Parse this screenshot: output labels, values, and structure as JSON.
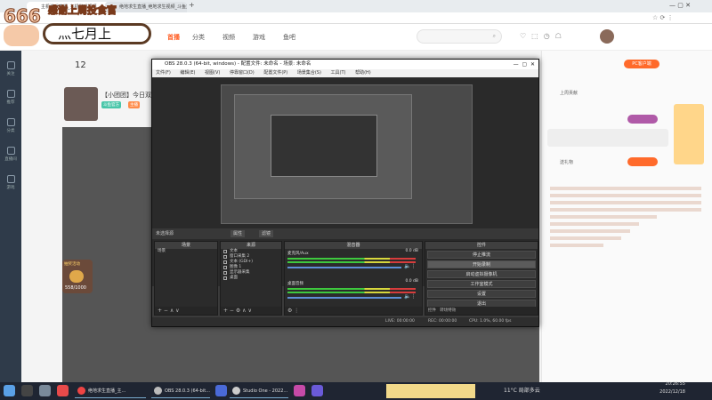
{
  "browser": {
    "tabs": [
      {
        "label": "主机游戏直播_主机游戏视频 ..."
      },
      {
        "label": "绝地求生直播_绝地求生视频_斗鱼直播"
      }
    ],
    "tab_new": "+"
  },
  "site": {
    "nav": [
      "首播",
      "分类",
      "视频",
      "游戏",
      "鱼吧"
    ],
    "active_nav": "首播",
    "search_placeholder": "",
    "user_count": "12"
  },
  "overlay": {
    "logo": "666",
    "banner": "感谢上周投食官",
    "pill_name": "灬七月上"
  },
  "left_rail": [
    "关注",
    "推荐",
    "分类",
    "直播间",
    "游戏"
  ],
  "anchor": {
    "name": "【小团团】今日双",
    "tags": [
      "斗鱼官方",
      "主播"
    ]
  },
  "obs": {
    "title": "OBS 28.0.3 (64-bit, windows) - 配置文件: 未命名 - 场景: 未命名",
    "menu": [
      "文件(F)",
      "编辑(E)",
      "视图(V)",
      "停靠窗口(D)",
      "配置文件(P)",
      "场景集合(S)",
      "工具(T)",
      "帮助(H)"
    ],
    "source_bar_label": "未选择源",
    "source_bar_buttons": [
      "属性",
      "滤镜"
    ],
    "docks": {
      "scenes": {
        "title": "场景",
        "items": [
          "场景"
        ]
      },
      "sources": {
        "title": "来源",
        "items": [
          "文本",
          "窗口采集 2",
          "文本 (GDI+)",
          "图像 1",
          "显示器采集",
          "桌面"
        ]
      },
      "mixer": {
        "title": "混音器",
        "channels": [
          {
            "name": "麦克风/Aux",
            "db": "0.0 dB"
          },
          {
            "name": "桌面音频",
            "db": "0.0 dB"
          }
        ]
      },
      "controls": {
        "title": "控件",
        "buttons": [
          "停止推流",
          "开始录制",
          "启动虚拟摄像机",
          "工作室模式",
          "设置",
          "退出"
        ],
        "tabs": [
          "控件",
          "转场特效"
        ]
      }
    },
    "status": {
      "live": "LIVE: 00:00:00",
      "rec": "REC: 00:00:00",
      "cpu": "CPU: 1.0%, 60.00 fps"
    }
  },
  "right_panel": {
    "chips": [
      "PC客户端"
    ],
    "rank_label": "上周贡献",
    "gift_label": "送礼物"
  },
  "promo": {
    "label": "抽奖活动",
    "count": "558/1000"
  },
  "taskbar": {
    "apps": [
      "绝地求生直播_主...",
      "OBS 28.0.3 (64-bit...",
      "Studio One - 2022..."
    ],
    "weather": "11°C 局部多云",
    "time": "20:26:55",
    "date": "2022/12/18"
  }
}
